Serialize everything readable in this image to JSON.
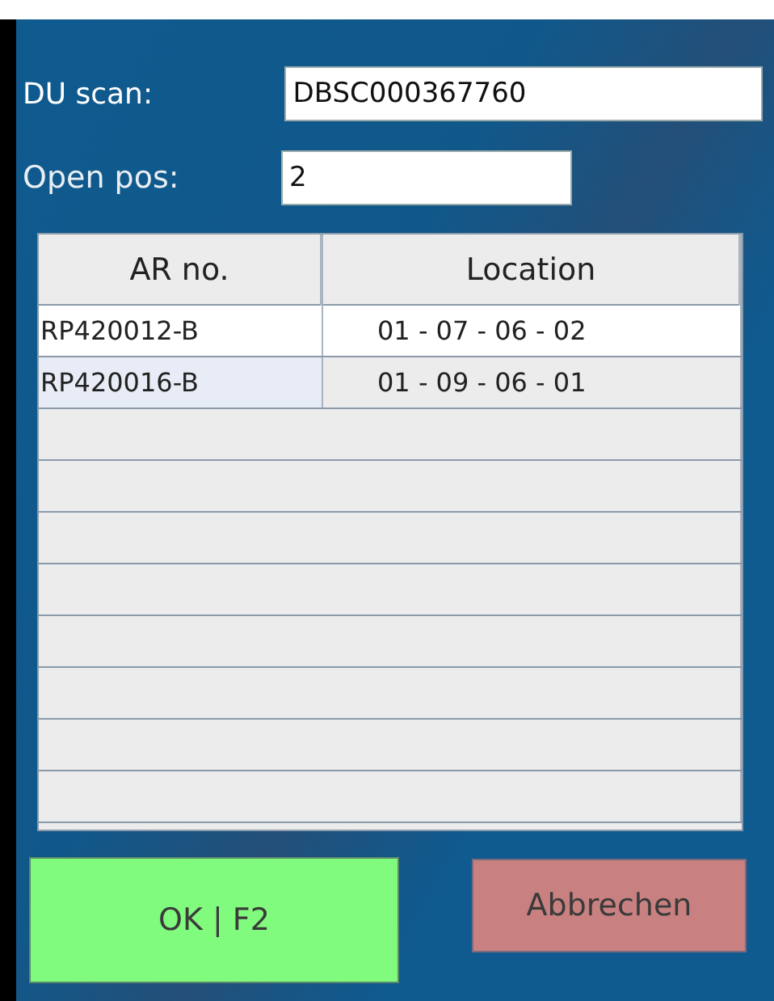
{
  "fields": [
    {
      "label": "DU scan:",
      "value": "DBSC000367760"
    },
    {
      "label": "Open pos:",
      "value": "2"
    }
  ],
  "table": {
    "columns": [
      "AR no.",
      "Location"
    ],
    "rows": [
      {
        "cells": [
          "RP420012-B",
          "01 - 07 - 06 - 02"
        ],
        "selected": true
      },
      {
        "cells": [
          "RP420016-B",
          "01 - 09 - 06 - 01"
        ],
        "selected": false
      }
    ]
  },
  "buttons": [
    {
      "label": "OK | F2",
      "kind": "confirm"
    },
    {
      "label": "Abbrechen",
      "kind": "cancel"
    }
  ]
}
